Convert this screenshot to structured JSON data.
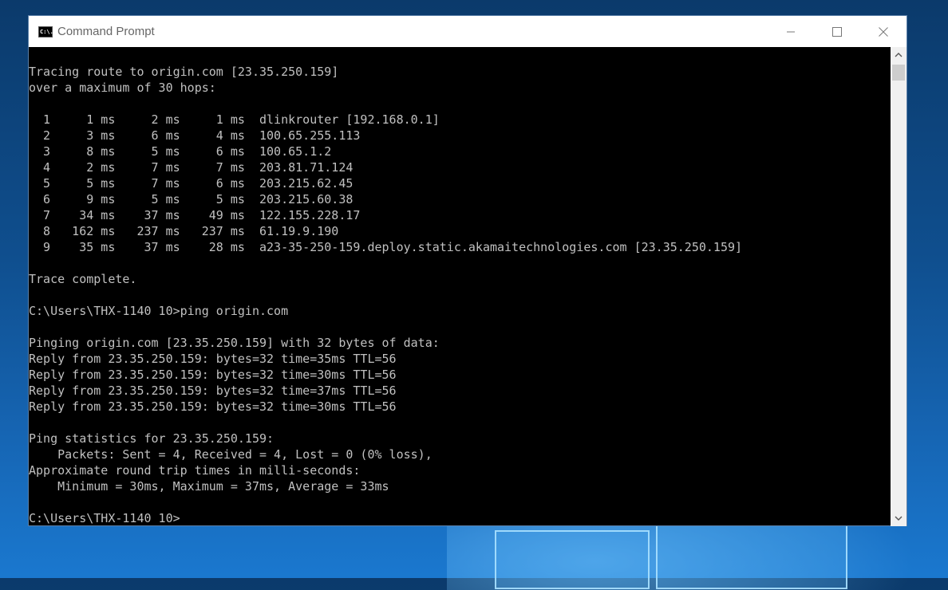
{
  "window": {
    "title": "Command Prompt",
    "icon_label": "C:\\."
  },
  "controls": [
    "minimize-icon",
    "maximize-icon",
    "close-icon"
  ],
  "console": {
    "lines": [
      "Tracing route to origin.com [23.35.250.159]",
      "over a maximum of 30 hops:",
      "",
      "  1     1 ms     2 ms     1 ms  dlinkrouter [192.168.0.1]",
      "  2     3 ms     6 ms     4 ms  100.65.255.113",
      "  3     8 ms     5 ms     6 ms  100.65.1.2",
      "  4     2 ms     7 ms     7 ms  203.81.71.124",
      "  5     5 ms     7 ms     6 ms  203.215.62.45",
      "  6     9 ms     5 ms     5 ms  203.215.60.38",
      "  7    34 ms    37 ms    49 ms  122.155.228.17",
      "  8   162 ms   237 ms   237 ms  61.19.9.190",
      "  9    35 ms    37 ms    28 ms  a23-35-250-159.deploy.static.akamaitechnologies.com [23.35.250.159]",
      "",
      "Trace complete.",
      "",
      "C:\\Users\\THX-1140 10>ping origin.com",
      "",
      "Pinging origin.com [23.35.250.159] with 32 bytes of data:",
      "Reply from 23.35.250.159: bytes=32 time=35ms TTL=56",
      "Reply from 23.35.250.159: bytes=32 time=30ms TTL=56",
      "Reply from 23.35.250.159: bytes=32 time=37ms TTL=56",
      "Reply from 23.35.250.159: bytes=32 time=30ms TTL=56",
      "",
      "Ping statistics for 23.35.250.159:",
      "    Packets: Sent = 4, Received = 4, Lost = 0 (0% loss),",
      "Approximate round trip times in milli-seconds:",
      "    Minimum = 30ms, Maximum = 37ms, Average = 33ms",
      "",
      "C:\\Users\\THX-1140 10>"
    ]
  }
}
